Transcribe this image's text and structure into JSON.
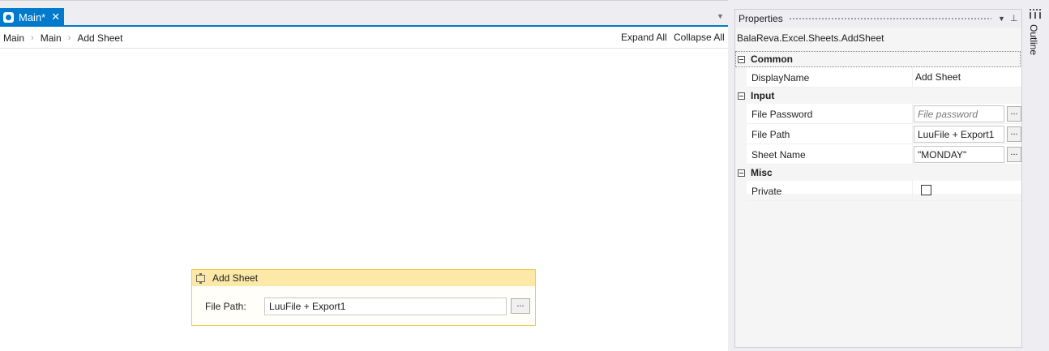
{
  "tab": {
    "title": "Main*",
    "close_glyph": "✕",
    "icon": "workflow-icon",
    "dropdown_glyph": "▼"
  },
  "breadcrumb": {
    "items": [
      "Main",
      "Main",
      "Add Sheet"
    ],
    "separator": "›"
  },
  "toolbar": {
    "expand_all": "Expand All",
    "collapse_all": "Collapse All"
  },
  "activity": {
    "title": "Add Sheet",
    "file_path_label": "File Path:",
    "file_path_value": "LuuFile + Export1",
    "browse_label": "..."
  },
  "properties": {
    "title": "Properties",
    "dropdown_glyph": "▼",
    "pin_glyph": "📌",
    "type_name": "BalaReva.Excel.Sheets.AddSheet",
    "categories": [
      {
        "name": "Common"
      },
      {
        "name": "Input"
      },
      {
        "name": "Misc"
      }
    ],
    "display_name": {
      "label": "DisplayName",
      "value": "Add Sheet"
    },
    "file_password": {
      "label": "File Password",
      "placeholder": "File password",
      "button": "..."
    },
    "file_path": {
      "label": "File Path",
      "value": "LuuFile + Export1",
      "button": "..."
    },
    "sheet_name": {
      "label": "Sheet Name",
      "value": "\"MONDAY\"",
      "button": "..."
    },
    "private": {
      "label": "Private",
      "checked": false
    }
  },
  "outline": {
    "label": "Outline"
  },
  "colors": {
    "accent": "#007acc",
    "activity_header": "#fce9a8",
    "activity_border": "#f2c94c"
  }
}
